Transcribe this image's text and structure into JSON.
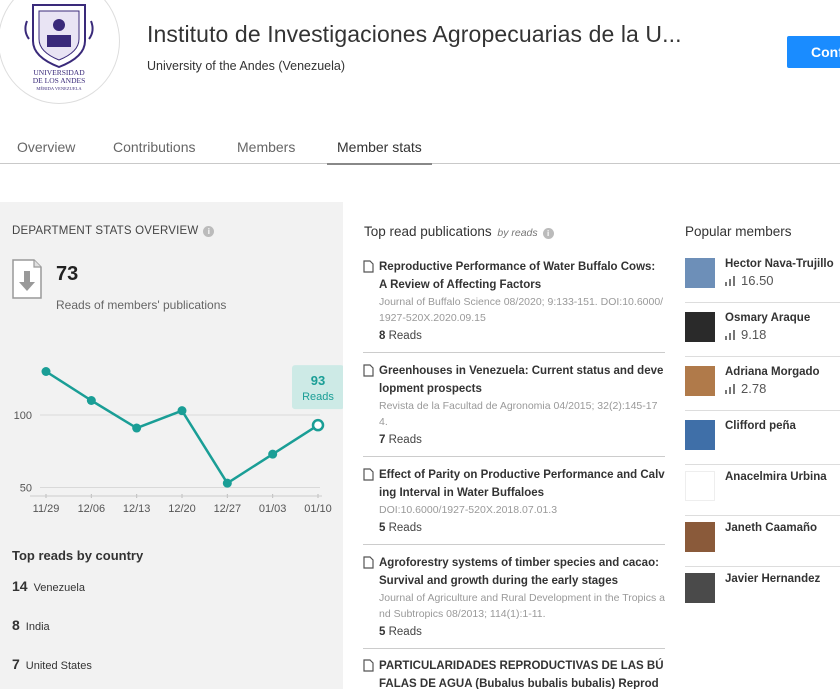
{
  "header": {
    "title": "Instituto de Investigaciones Agropecuarias de la U...",
    "subtitle": "University of the Andes (Venezuela)",
    "confirm_label": "Conf",
    "logo_text_1": "UNIVERSIDAD",
    "logo_text_2": "DE LOS ANDES",
    "logo_text_3": "MÉRIDA VENEZUELA"
  },
  "tabs": [
    {
      "label": "Overview"
    },
    {
      "label": "Contributions"
    },
    {
      "label": "Members"
    },
    {
      "label": "Member stats",
      "active": true
    }
  ],
  "dept": {
    "title": "DEPARTMENT STATS OVERVIEW",
    "reads_count": "73",
    "reads_label": "Reads of members' publications"
  },
  "chart_data": {
    "type": "line",
    "x": [
      "11/29",
      "12/06",
      "12/13",
      "12/20",
      "12/27",
      "01/03",
      "01/10"
    ],
    "series": [
      {
        "values": [
          130,
          110,
          91,
          103,
          53,
          73,
          93
        ]
      }
    ],
    "yticks": [
      50,
      100
    ],
    "ylim": [
      40,
      140
    ],
    "tooltip": {
      "value": "93",
      "label": "Reads"
    },
    "color": "#1a9e96"
  },
  "countries": {
    "title": "Top reads by country",
    "items": [
      {
        "count": "14",
        "name": "Venezuela"
      },
      {
        "count": "8",
        "name": "India"
      },
      {
        "count": "7",
        "name": "United States"
      }
    ]
  },
  "publications": {
    "title": "Top read publications",
    "by_label": "by reads",
    "items": [
      {
        "title": "Reproductive Performance of Water Buffalo Cows: A Review of Affecting Factors",
        "meta": "Journal of Buffalo Science 08/2020; 9:133-151. DOI:10.6000/1927-520X.2020.09.15",
        "reads_num": "8",
        "reads_word": "Reads"
      },
      {
        "title": "Greenhouses in Venezuela: Current status and development prospects",
        "meta": "Revista de la Facultad de Agronomia 04/2015; 32(2):145-174.",
        "reads_num": "7",
        "reads_word": "Reads"
      },
      {
        "title": "Effect of Parity on Productive Performance and Calving Interval in Water Buffaloes",
        "meta": "DOI:10.6000/1927-520X.2018.07.01.3",
        "reads_num": "5",
        "reads_word": "Reads"
      },
      {
        "title": "Agroforestry systems of timber species and cacao: Survival and growth during the early stages",
        "meta": "Journal of Agriculture and Rural Development in the Tropics and Subtropics 08/2013; 114(1):1-11.",
        "reads_num": "5",
        "reads_word": "Reads"
      },
      {
        "title": "PARTICULARIDADES REPRODUCTIVAS DE LAS BÚFALAS DE AGUA (Bubalus bubalis bubalis) Reproductiv",
        "meta": "",
        "reads_num": "",
        "reads_word": ""
      }
    ]
  },
  "members": {
    "title": "Popular members",
    "items": [
      {
        "name": "Hector Nava-Trujillo",
        "score": "16.50",
        "avatar_color": "#6d8fb8"
      },
      {
        "name": "Osmary Araque",
        "score": "9.18",
        "avatar_color": "#2a2a2a"
      },
      {
        "name": "Adriana Morgado",
        "score": "2.78",
        "avatar_color": "#b07a4a"
      },
      {
        "name": "Clifford peña",
        "score": "",
        "avatar_color": "#3f6fa8"
      },
      {
        "name": "Anacelmira Urbina",
        "score": "",
        "avatar_color": "#ffffff"
      },
      {
        "name": "Janeth Caamaño",
        "score": "",
        "avatar_color": "#8a5a3a"
      },
      {
        "name": "Javier Hernandez",
        "score": "",
        "avatar_color": "#4a4a4a"
      }
    ]
  }
}
